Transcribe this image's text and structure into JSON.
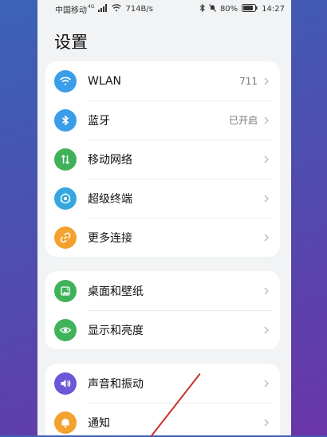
{
  "status": {
    "carrier": "中国移动",
    "network_badge": "4G",
    "speed": "714B/s",
    "battery": "80%",
    "time": "14:27"
  },
  "title": "设置",
  "groups": [
    {
      "items": [
        {
          "label": "WLAN",
          "value": "711",
          "icon": "wifi-icon",
          "color": "#3a9de8"
        },
        {
          "label": "蓝牙",
          "value": "已开启",
          "icon": "bluetooth-icon",
          "color": "#3a9de8"
        },
        {
          "label": "移动网络",
          "value": "",
          "icon": "mobile-network-icon",
          "color": "#3fb25a"
        },
        {
          "label": "超级终端",
          "value": "",
          "icon": "super-device-icon",
          "color": "#36a6de"
        },
        {
          "label": "更多连接",
          "value": "",
          "icon": "link-icon",
          "color": "#f3a22f"
        }
      ]
    },
    {
      "items": [
        {
          "label": "桌面和壁纸",
          "value": "",
          "icon": "wallpaper-icon",
          "color": "#3fb25a"
        },
        {
          "label": "显示和亮度",
          "value": "",
          "icon": "eye-icon",
          "color": "#3fb25a"
        }
      ]
    },
    {
      "items": [
        {
          "label": "声音和振动",
          "value": "",
          "icon": "speaker-icon",
          "color": "#6a58d8"
        },
        {
          "label": "通知",
          "value": "",
          "icon": "bell-icon",
          "color": "#f3a22f"
        }
      ]
    }
  ]
}
